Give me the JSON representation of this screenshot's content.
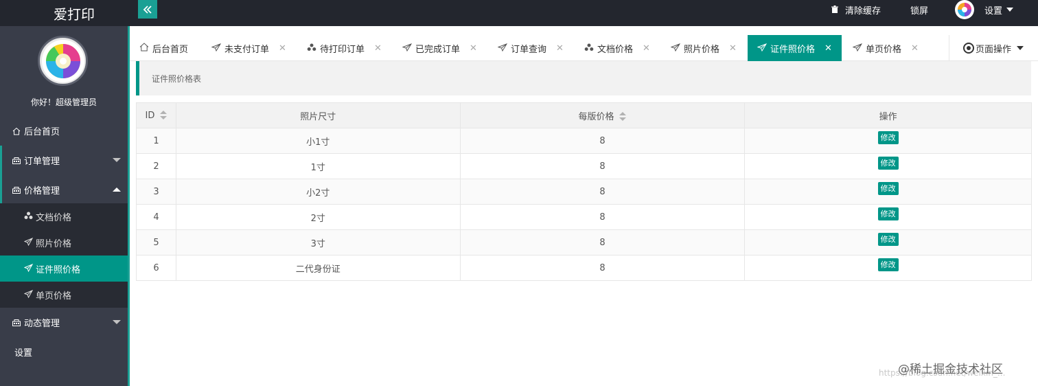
{
  "app": {
    "title": "爱打印"
  },
  "topbar": {
    "clear_cache": "清除缓存",
    "lock_screen": "锁屏",
    "settings": "设置"
  },
  "sidebar": {
    "greeting": "你好！超级管理员",
    "items": [
      {
        "label": "后台首页",
        "icon": "home-icon"
      },
      {
        "label": "订单管理",
        "icon": "building-icon"
      },
      {
        "label": "价格管理",
        "icon": "building-icon"
      },
      {
        "label": "动态管理",
        "icon": "building-icon"
      },
      {
        "label": "设置",
        "icon": ""
      }
    ],
    "sub_items": [
      {
        "label": "文档价格",
        "icon": "cluster-icon"
      },
      {
        "label": "照片价格",
        "icon": "paper-plane-icon"
      },
      {
        "label": "证件照价格",
        "icon": "paper-plane-icon"
      },
      {
        "label": "单页价格",
        "icon": "paper-plane-icon"
      }
    ]
  },
  "tabs": [
    {
      "label": "后台首页",
      "icon": "home-icon"
    },
    {
      "label": "未支付订单",
      "icon": "paper-plane-icon"
    },
    {
      "label": "待打印订单",
      "icon": "cluster-icon"
    },
    {
      "label": "已完成订单",
      "icon": "paper-plane-icon"
    },
    {
      "label": "订单查询",
      "icon": "paper-plane-icon"
    },
    {
      "label": "文档价格",
      "icon": "cluster-icon"
    },
    {
      "label": "照片价格",
      "icon": "paper-plane-icon"
    },
    {
      "label": "证件照价格",
      "icon": "paper-plane-icon"
    },
    {
      "label": "单页价格",
      "icon": "paper-plane-icon"
    }
  ],
  "page_operation": "页面操作",
  "section": {
    "title": "证件照价格表"
  },
  "table": {
    "columns": [
      "ID",
      "照片尺寸",
      "每版价格",
      "操作"
    ],
    "rows": [
      {
        "id": "1",
        "size": "小1寸",
        "price": "8",
        "action": "修改"
      },
      {
        "id": "2",
        "size": "1寸",
        "price": "8",
        "action": "修改"
      },
      {
        "id": "3",
        "size": "小2寸",
        "price": "8",
        "action": "修改"
      },
      {
        "id": "4",
        "size": "2寸",
        "price": "8",
        "action": "修改"
      },
      {
        "id": "5",
        "size": "3寸",
        "price": "8",
        "action": "修改"
      },
      {
        "id": "6",
        "size": "二代身份证",
        "price": "8",
        "action": "修改"
      }
    ]
  },
  "watermark": {
    "text": "@稀土掘金技术社区",
    "url": "https://blog.csdn.net/weixin_..."
  },
  "colors": {
    "accent": "#009688",
    "topbar": "#23262e",
    "sidebar": "#393d49"
  }
}
